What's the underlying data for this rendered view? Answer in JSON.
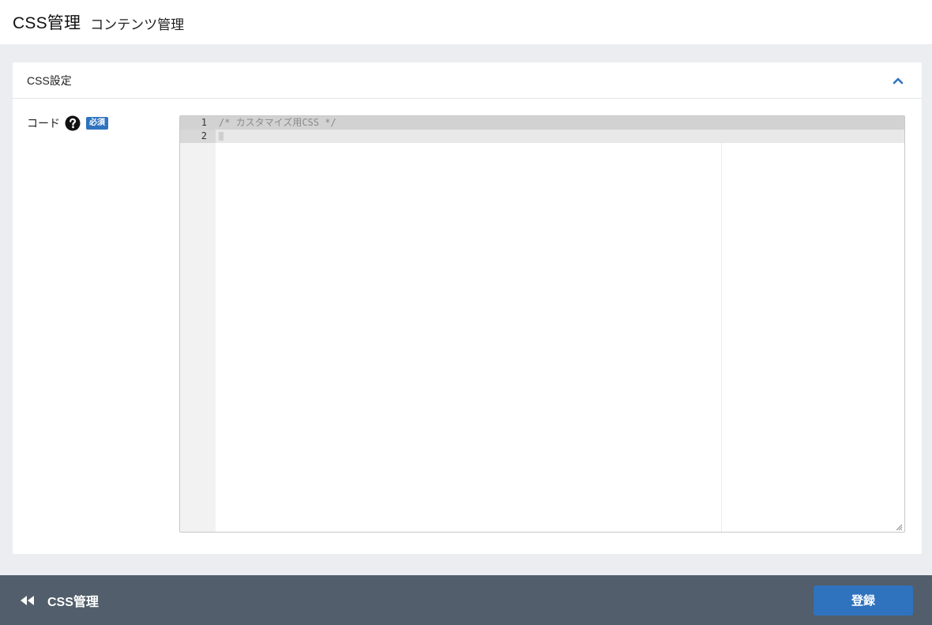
{
  "header": {
    "title": "CSS管理",
    "subtitle": "コンテンツ管理"
  },
  "card": {
    "title": "CSS設定",
    "collapse_icon": "chevron-up-icon"
  },
  "field": {
    "label": "コード",
    "help_icon": "question-circle-icon",
    "required_badge": "必須"
  },
  "editor": {
    "lines": [
      {
        "number": "1",
        "text": "/* カスタマイズ用CSS */"
      },
      {
        "number": "2",
        "text": ""
      }
    ]
  },
  "footer": {
    "back_label": "CSS管理",
    "back_icon": "double-chevron-left-icon",
    "submit_label": "登録"
  },
  "colors": {
    "accent": "#2f73bf",
    "footer_bg": "#525e6b",
    "page_bg": "#ebedf1"
  }
}
